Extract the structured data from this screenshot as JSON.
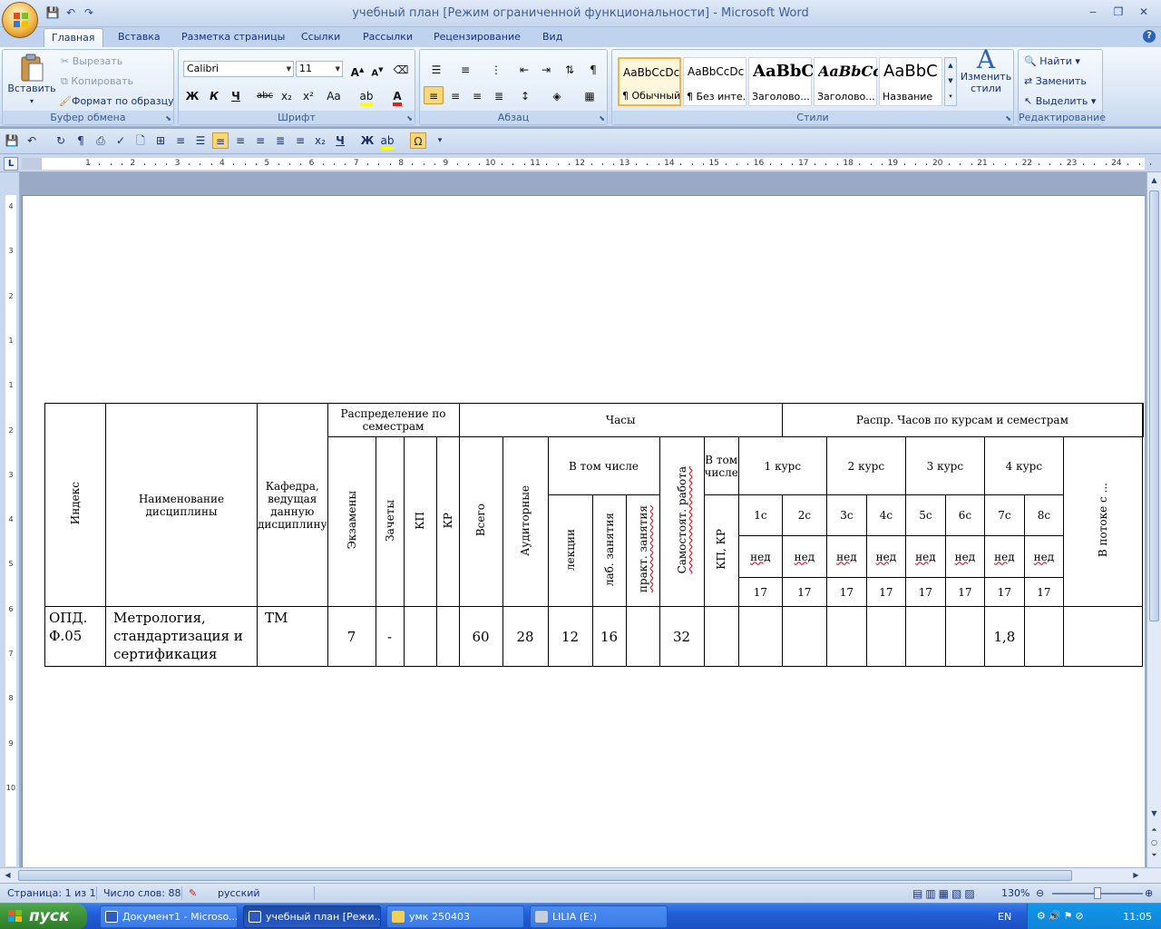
{
  "window": {
    "title": "учебный план [Режим ограниченной функциональности] - Microsoft Word",
    "minimize": "‒",
    "restore": "❐",
    "close": "✕"
  },
  "tabs": [
    "Главная",
    "Вставка",
    "Разметка страницы",
    "Ссылки",
    "Рассылки",
    "Рецензирование",
    "Вид"
  ],
  "ribbon": {
    "clipboard": {
      "label": "Буфер обмена",
      "paste": "Вставить",
      "cut": "Вырезать",
      "copy": "Копировать",
      "format_painter": "Формат по образцу"
    },
    "font": {
      "label": "Шрифт",
      "family": "Calibri",
      "size": "11",
      "bold": "Ж",
      "italic": "К",
      "underline": "Ч",
      "strike": "abc",
      "sub": "x₂",
      "sup": "x²",
      "case": "Aa"
    },
    "paragraph": {
      "label": "Абзац"
    },
    "styles": {
      "label": "Стили",
      "change": "Изменить стили",
      "items": [
        {
          "sample": "AaBbCcDc",
          "name": "¶ Обычный"
        },
        {
          "sample": "AaBbCcDc",
          "name": "¶ Без инте..."
        },
        {
          "sample": "AaBbC",
          "name": "Заголово..."
        },
        {
          "sample": "AaBbCc",
          "name": "Заголово..."
        },
        {
          "sample": "AaBbC",
          "name": "Название"
        }
      ]
    },
    "editing": {
      "label": "Редактирование",
      "find": "Найти",
      "replace": "Заменить",
      "select": "Выделить"
    }
  },
  "ruler": {
    "h": [
      "1",
      "2",
      "3",
      "4",
      "5",
      "6",
      "7",
      "8",
      "9",
      "10",
      "11",
      "12",
      "13",
      "14",
      "15",
      "16",
      "17",
      "18",
      "19",
      "20",
      "21",
      "22",
      "23",
      "24"
    ],
    "v": [
      "4",
      "3",
      "2",
      "1",
      "1",
      "2",
      "3",
      "4",
      "5",
      "6",
      "7",
      "8",
      "9",
      "10"
    ]
  },
  "table": {
    "h_index": "Индекс",
    "h_name": "Наименование дисциплины",
    "h_dept": "Кафедра, ведущая данную дисциплину",
    "h_dist": "Распределение по семестрам",
    "h_exams": "Экзамены",
    "h_credits": "Зачеты",
    "h_kp": "КП",
    "h_kr": "КР",
    "h_hours": "Часы",
    "h_total": "Всего",
    "h_aud": "Аудиторные",
    "h_incl": "В том числе",
    "h_lect": "лекции",
    "h_lab": "лаб. занятия",
    "h_prac": "практ. занятия",
    "h_self": "Самостоят. работа",
    "h_incl2": "В том числе",
    "h_kpkr": "КП, КР",
    "h_distr": "Распр. Часов по курсам и семестрам",
    "h_stream": "В потоке с ...",
    "courses": [
      "1 курс",
      "2 курс",
      "3 курс",
      "4 курс"
    ],
    "semesters": [
      "1с",
      "2с",
      "3с",
      "4с",
      "5с",
      "6с",
      "7с",
      "8с"
    ],
    "ned": [
      "нед",
      "нед",
      "нед",
      "нед",
      "нед",
      "нед",
      "нед",
      "нед"
    ],
    "weeks": [
      "17",
      "17",
      "17",
      "17",
      "17",
      "17",
      "17",
      "17"
    ],
    "row": {
      "index": "ОПД. Ф.05",
      "name": "Метрология, стандартизация и сертификация",
      "dept": "ТМ",
      "exams": "7",
      "credits": "-",
      "total": "60",
      "aud": "28",
      "lect": "12",
      "lab": "16",
      "self": "32",
      "s7": "1,8"
    }
  },
  "status": {
    "page": "Страница: 1 из 1",
    "words": "Число слов: 88",
    "lang": "русский",
    "zoom": "130%"
  },
  "taskbar": {
    "start": "пуск",
    "tasks": [
      "Документ1 - Microso...",
      "учебный план [Режи...",
      "умк 250403",
      "LILIA (E:)"
    ],
    "lang": "EN",
    "time": "11:05"
  },
  "colors": {
    "accent": "#fbd778",
    "ribbon": "#dce8f6",
    "taskbar": "#225ed8",
    "start": "#3c9037"
  }
}
